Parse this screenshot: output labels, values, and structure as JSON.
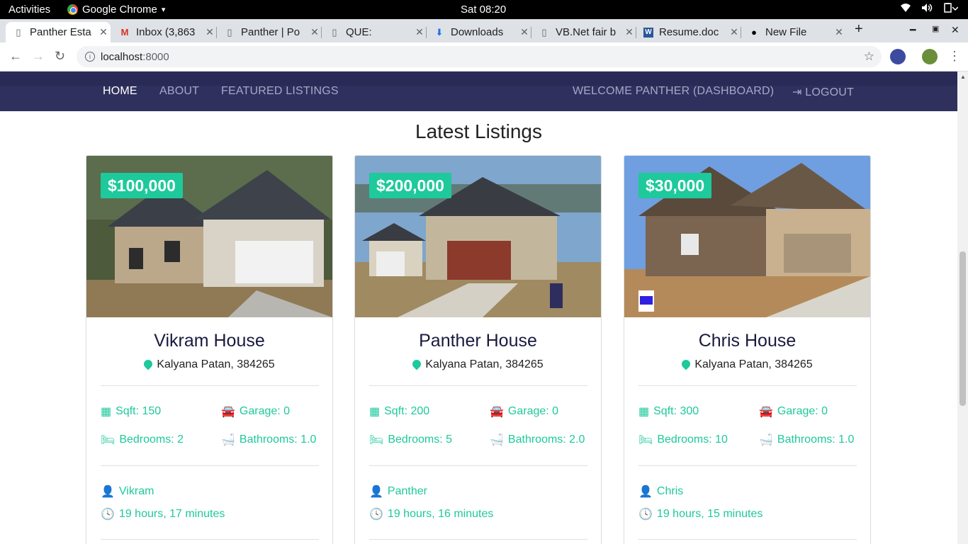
{
  "topbar": {
    "activities": "Activities",
    "app": "Google Chrome",
    "app_caret": "▾",
    "clock": "Sat 08:20",
    "wifi": "wifi-icon",
    "volume": "volume-icon",
    "battery": "battery-icon"
  },
  "tabs": [
    {
      "title": "Panther Esta",
      "icon": "page-icon"
    },
    {
      "title": "Inbox (3,863",
      "icon": "gmail-icon"
    },
    {
      "title": "Panther | Po",
      "icon": "page-icon"
    },
    {
      "title": "QUE:",
      "icon": "page-icon"
    },
    {
      "title": "Downloads",
      "icon": "download-icon"
    },
    {
      "title": "VB.Net fair b",
      "icon": "page-icon"
    },
    {
      "title": "Resume.doc",
      "icon": "word-icon"
    },
    {
      "title": "New File",
      "icon": "github-icon"
    }
  ],
  "toolbar": {
    "url_host": "localhost",
    "url_port": ":8000"
  },
  "nav": {
    "home": "HOME",
    "about": "ABOUT",
    "featured": "FEATURED LISTINGS",
    "welcome": "WELCOME PANTHER (DASHBOARD)",
    "logout": "LOGOUT"
  },
  "section_title": "Latest Listings",
  "listings": [
    {
      "price": "$100,000",
      "title": "Vikram House",
      "address": "Kalyana Patan, 384265",
      "sqft": "Sqft: 150",
      "garage": "Garage: 0",
      "bedrooms": "Bedrooms: 2",
      "bathrooms": "Bathrooms: 1.0",
      "realtor": "Vikram",
      "time": "19 hours, 17 minutes"
    },
    {
      "price": "$200,000",
      "title": "Panther House",
      "address": "Kalyana Patan, 384265",
      "sqft": "Sqft: 200",
      "garage": "Garage: 0",
      "bedrooms": "Bedrooms: 5",
      "bathrooms": "Bathrooms: 2.0",
      "realtor": "Panther",
      "time": "19 hours, 16 minutes"
    },
    {
      "price": "$30,000",
      "title": "Chris House",
      "address": "Kalyana Patan, 384265",
      "sqft": "Sqft: 300",
      "garage": "Garage: 0",
      "bedrooms": "Bedrooms: 10",
      "bathrooms": "Bathrooms: 1.0",
      "realtor": "Chris",
      "time": "19 hours, 15 minutes"
    }
  ],
  "colors": {
    "accent": "#1ec99b",
    "navbar": "#30305e"
  }
}
